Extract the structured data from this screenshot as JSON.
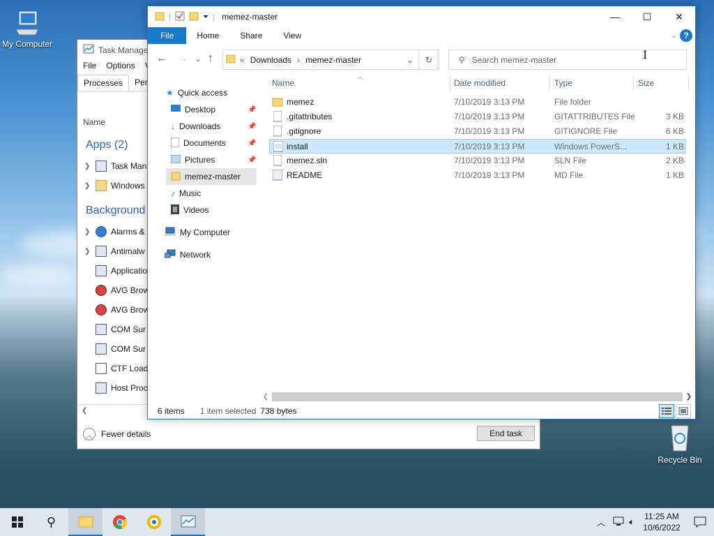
{
  "desktop": {
    "icons": [
      {
        "label": "My Computer"
      },
      {
        "label": "Recycle Bin"
      }
    ]
  },
  "task_manager": {
    "title": "Task Manager",
    "menu": [
      "File",
      "Options",
      "V"
    ],
    "tabs": [
      "Processes",
      "Perfo"
    ],
    "column_name": "Name",
    "apps_heading": "Apps (2)",
    "apps": [
      "Task Man",
      "Windows"
    ],
    "background_heading": "Background p",
    "background": [
      "Alarms &",
      "Antimalw",
      "Applicatio",
      "AVG Brow",
      "AVG Brow",
      "COM Sur",
      "COM Sur",
      "CTF Load",
      "Host Proc"
    ],
    "fewer_details": "Fewer details",
    "end_task": "End task"
  },
  "explorer": {
    "title": "memez-master",
    "ribbon_tabs": [
      "File",
      "Home",
      "Share",
      "View"
    ],
    "address": {
      "prefix": "«",
      "segments": [
        "Downloads",
        "memez-master"
      ]
    },
    "search_placeholder": "Search memez-master",
    "nav": {
      "quick_access": "Quick access",
      "pinned": [
        "Desktop",
        "Downloads",
        "Documents",
        "Pictures"
      ],
      "current": "memez-master",
      "others": [
        "Music",
        "Videos"
      ],
      "my_computer": "My Computer",
      "network": "Network"
    },
    "columns": {
      "name": "Name",
      "date": "Date modified",
      "type": "Type",
      "size": "Size"
    },
    "files": [
      {
        "name": "memez",
        "date": "7/10/2019 3:13 PM",
        "type": "File folder",
        "size": ""
      },
      {
        "name": ".gitattributes",
        "date": "7/10/2019 3:13 PM",
        "type": "GITATTRIBUTES File",
        "size": "3 KB"
      },
      {
        "name": ".gitignore",
        "date": "7/10/2019 3:13 PM",
        "type": "GITIGNORE File",
        "size": "6 KB"
      },
      {
        "name": "install",
        "date": "7/10/2019 3:13 PM",
        "type": "Windows PowerS...",
        "size": "1 KB"
      },
      {
        "name": "memez.sln",
        "date": "7/10/2019 3:13 PM",
        "type": "SLN File",
        "size": "2 KB"
      },
      {
        "name": "README",
        "date": "7/10/2019 3:13 PM",
        "type": "MD File",
        "size": "1 KB"
      }
    ],
    "status": {
      "items": "6 items",
      "selected": "1 item selected",
      "bytes": "738 bytes"
    }
  },
  "taskbar": {
    "time": "11:25 AM",
    "date": "10/6/2022"
  }
}
